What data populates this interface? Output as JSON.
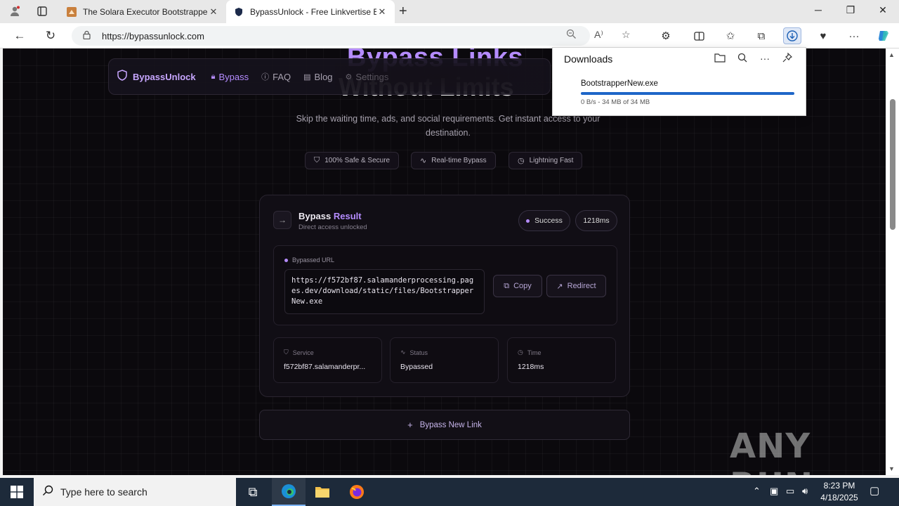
{
  "browser": {
    "tabs": [
      {
        "title": "The Solara Executor Bootstrapper",
        "close": "✕"
      },
      {
        "title": "BypassUnlock - Free Linkvertise B",
        "close": "✕"
      }
    ],
    "new_tab": "+",
    "url": "https://bypassunlock.com"
  },
  "page": {
    "hero_line1": "Bypass Links",
    "hero_line2": "Without Limits",
    "nav": {
      "brand": "BypassUnlock",
      "links": [
        "Bypass",
        "FAQ",
        "Blog",
        "Settings"
      ]
    },
    "subtitle": "Skip the waiting time, ads, and social requirements. Get instant access to your destination.",
    "features": [
      "100% Safe & Secure",
      "Real-time Bypass",
      "Lightning Fast"
    ],
    "result": {
      "title_main": "Bypass ",
      "title_accent": "Result",
      "subtitle": "Direct access unlocked",
      "status_pill": "Success",
      "time_pill": "1218ms",
      "url_label": "Bypassed URL",
      "url": "https://f572bf87.salamanderprocessing.pages.dev/download/static/files/BootstrapperNew.exe",
      "copy_label": "Copy",
      "redirect_label": "Redirect",
      "stats": [
        {
          "label": "Service",
          "value": "f572bf87.salamanderpr..."
        },
        {
          "label": "Status",
          "value": "Bypassed"
        },
        {
          "label": "Time",
          "value": "1218ms"
        }
      ]
    },
    "new_link_label": "Bypass New Link",
    "watermark": "ANY RUN"
  },
  "downloads": {
    "title": "Downloads",
    "file": "BootstrapperNew.exe",
    "meta": "0 B/s - 34 MB of 34 MB",
    "progress": 1.0
  },
  "taskbar": {
    "search_placeholder": "Type here to search",
    "time": "8:23 PM",
    "date": "4/18/2025"
  },
  "colors": {
    "accent": "#b58cff",
    "page_bg": "#0b090d",
    "download_progress": "#1e66c8",
    "taskbar": "#1d2a3a"
  }
}
